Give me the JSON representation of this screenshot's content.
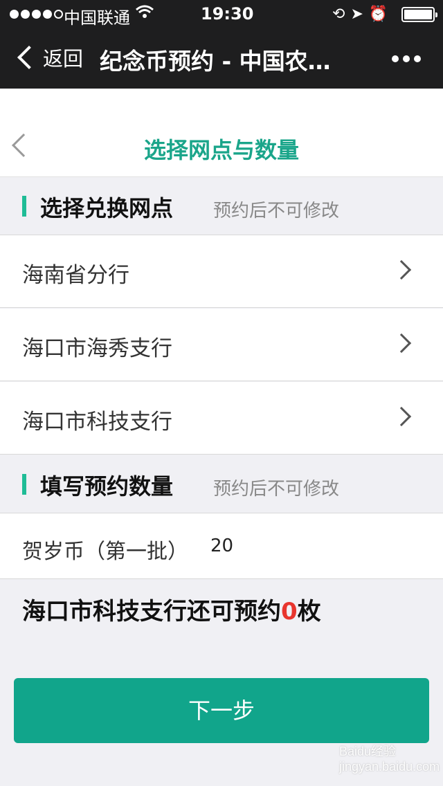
{
  "status_bar": {
    "carrier": "中国联通",
    "time": "19:30",
    "signal_bars_filled": 4,
    "signal_bars_total": 5,
    "icons": [
      "wifi-icon",
      "lock-rotation-icon",
      "location-arrow-icon",
      "alarm-icon",
      "battery-icon"
    ]
  },
  "nav": {
    "back_label": "返回",
    "title": "纪念币预约 - 中国农…",
    "more_icon": "more-dots-icon"
  },
  "page": {
    "title": "选择网点与数量",
    "title_color": "#1aa58a"
  },
  "branch_section": {
    "title": "选择兑换网点",
    "note": "预约后不可修改",
    "items": [
      {
        "label": "海南省分行"
      },
      {
        "label": "海口市海秀支行"
      },
      {
        "label": "海口市科技支行"
      }
    ]
  },
  "quantity_section": {
    "title": "填写预约数量",
    "note": "预约后不可修改",
    "coin_label": "贺岁币（第一批）",
    "quantity_value": "20"
  },
  "remaining": {
    "prefix": "海口市科技支行还可预约",
    "count": "0",
    "suffix": "枚",
    "count_color": "#e8352e"
  },
  "next_button": {
    "label": "下一步",
    "color": "#11a58b"
  },
  "watermark": {
    "text": "Baidu经验 jingyan.baidu.com"
  }
}
